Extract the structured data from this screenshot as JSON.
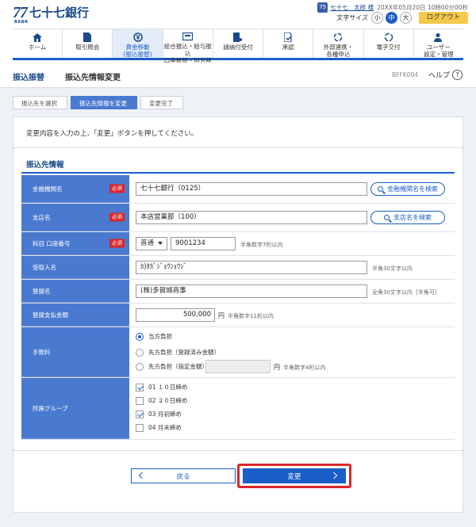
{
  "header": {
    "logo_mark": "77",
    "logo_bank": "BANK",
    "logo_name": "七十七銀行",
    "user_icon": "75",
    "user_name": "七十七　太郎 様",
    "login_time": "20XX年05月20日 10時00分00秒",
    "font_size_label": "文字サイズ",
    "font_small": "小",
    "font_medium": "中",
    "font_large": "大",
    "logout": "ログアウト"
  },
  "gnav": {
    "items": [
      {
        "label1": "ホーム",
        "label2": "",
        "icon": "home-icon"
      },
      {
        "label1": "取引照会",
        "label2": "",
        "icon": "document-icon"
      },
      {
        "label1": "資金移動",
        "label2": "(振込振替)",
        "icon": "transfer-icon"
      },
      {
        "label1": "総合振込・給与振込",
        "label2": "口座振替・地方税",
        "icon": "card-icon"
      },
      {
        "label1": "請納付受付",
        "label2": "",
        "icon": "payment-icon"
      },
      {
        "label1": "承認",
        "label2": "",
        "icon": "approval-icon"
      },
      {
        "label1": "外部連携・",
        "label2": "各種申込",
        "icon": "link-icon"
      },
      {
        "label1": "電子交付",
        "label2": "",
        "icon": "delivery-icon"
      },
      {
        "label1": "ユーザー",
        "label2": "設定・管理",
        "icon": "user-settings-icon"
      }
    ]
  },
  "title": {
    "category": "振込振替",
    "main": "振込先情報変更",
    "screen_id": "BFFK004",
    "help": "ヘルプ",
    "help_icon": "?"
  },
  "steps": [
    "振込先を選択",
    "振込先情報を変更",
    "変更完了"
  ],
  "instruction": "変更内容を入力の上、「変更」ボタンを押してください。",
  "section_title": "振込先情報",
  "required_label": "必須",
  "form": {
    "bank": {
      "label": "金融機関名",
      "value": "七十七銀行（0125）",
      "button": "金融機関名を検索"
    },
    "branch": {
      "label": "支店名",
      "value": "本店営業部（100）",
      "button": "支店名を検索"
    },
    "account": {
      "label": "科目 口座番号",
      "type": "普通",
      "number": "9001234",
      "hint": "半角数字7桁以内"
    },
    "recipient": {
      "label": "受取人名",
      "value": "ｶ)ﾀｶﾞｼﾞｮｳｼｮｳｼﾞ",
      "hint": "半角30文字以内"
    },
    "reg_name": {
      "label": "登録名",
      "value": "(株)多賀城商事",
      "hint": "全角30文字以内［半角可］"
    },
    "amount": {
      "label": "登録支払金額",
      "value": "500,000",
      "unit": "円",
      "hint": "半角数字11桁以内"
    },
    "fee": {
      "label": "手数料",
      "options": [
        "当方負担",
        "先方負担（登録済み金額）",
        "先方負担（指定金額）"
      ],
      "selected": 0,
      "unit": "円",
      "hint": "半角数字4桁以内"
    },
    "group": {
      "label": "所属グループ",
      "options": [
        "01 １０日締め",
        "02 ２０日締め",
        "03 月初締め",
        "04 月末締め"
      ],
      "checked": [
        true,
        false,
        true,
        false
      ]
    }
  },
  "buttons": {
    "back": "戻る",
    "change": "変更"
  },
  "colors": {
    "primary": "#1a5ec8",
    "label_bg": "#4a7ad0",
    "required": "#d9262a",
    "logout": "#f6c94a"
  }
}
